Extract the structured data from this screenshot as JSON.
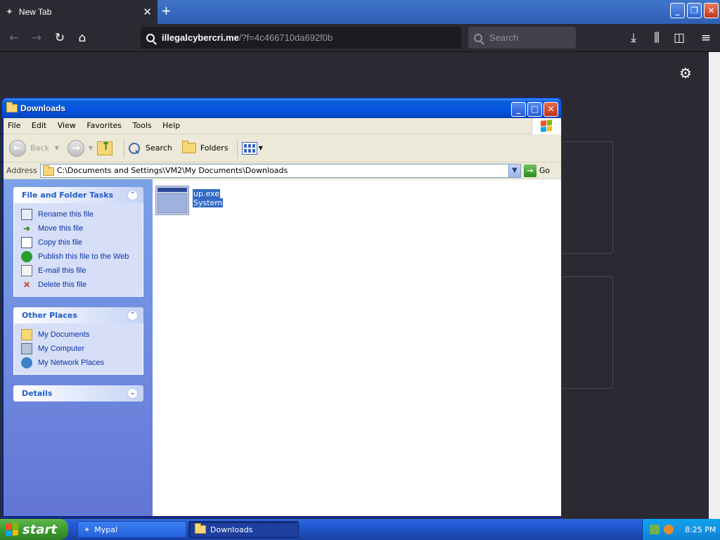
{
  "browser": {
    "tab_title": "New Tab",
    "tab_close": "✕",
    "new_tab": "+",
    "url_domain": "illegalcybercri.me",
    "url_path": "/?f=4c466710da692f0b",
    "search_placeholder": "Search"
  },
  "explorer": {
    "title": "Downloads",
    "menu": [
      "File",
      "Edit",
      "View",
      "Favorites",
      "Tools",
      "Help"
    ],
    "toolbar": {
      "back": "Back",
      "search": "Search",
      "folders": "Folders"
    },
    "address_label": "Address",
    "address_value": "C:\\Documents and Settings\\VM2\\My Documents\\Downloads",
    "go": "Go",
    "file_tasks": {
      "title": "File and Folder Tasks",
      "items": [
        "Rename this file",
        "Move this file",
        "Copy this file",
        "Publish this file to the Web",
        "E-mail this file",
        "Delete this file"
      ]
    },
    "other_places": {
      "title": "Other Places",
      "items": [
        "My Documents",
        "My Computer",
        "My Network Places"
      ]
    },
    "details": {
      "title": "Details"
    },
    "file": {
      "name": "up.exe",
      "type": "System"
    }
  },
  "taskbar": {
    "start": "start",
    "items": [
      "Mypal",
      "Downloads"
    ],
    "clock": "8:25 PM"
  }
}
